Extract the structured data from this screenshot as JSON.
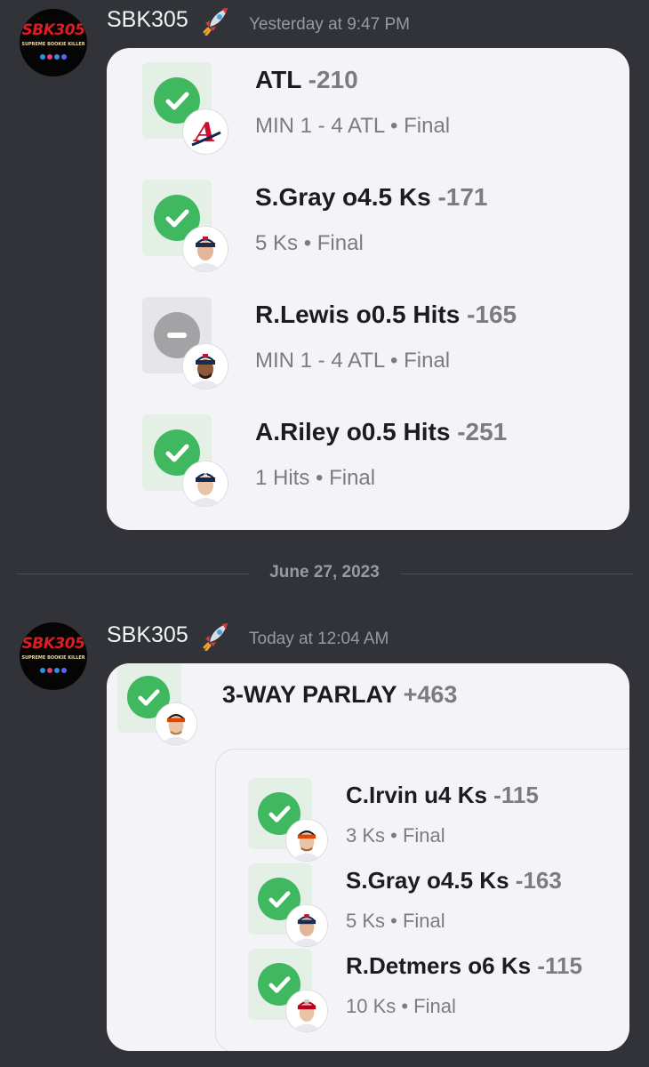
{
  "messages": [
    {
      "username": "SBK305",
      "timestamp": "Yesterday at 9:47 PM",
      "avatar": {
        "logo_text": "SBK305",
        "logo_sub": "SUPREME BOOKIE KILLER"
      },
      "legs": [
        {
          "title": "ATL",
          "odds": "-210",
          "sub": "MIN 1 - 4 ATL • Final",
          "status": "win",
          "badge": "atlanta-braves-logo"
        },
        {
          "title": "S.Gray o4.5 Ks",
          "odds": "-171",
          "sub": "5 Ks • Final",
          "status": "win",
          "badge": "player-headshot"
        },
        {
          "title": "R.Lewis o0.5 Hits",
          "odds": "-165",
          "sub": "MIN 1 - 4 ATL • Final",
          "status": "push",
          "badge": "player-headshot"
        },
        {
          "title": "A.Riley o0.5 Hits",
          "odds": "-251",
          "sub": "1 Hits • Final",
          "status": "win",
          "badge": "player-headshot"
        }
      ]
    },
    {
      "username": "SBK305",
      "timestamp": "Today at 12:04 AM",
      "avatar": {
        "logo_text": "SBK305",
        "logo_sub": "SUPREME BOOKIE KILLER"
      },
      "parlay": {
        "title": "3-WAY PARLAY",
        "odds": "+463",
        "status": "win"
      },
      "legs": [
        {
          "title": "C.Irvin u4 Ks",
          "odds": "-115",
          "sub": "3 Ks • Final",
          "status": "win",
          "badge": "player-headshot"
        },
        {
          "title": "S.Gray o4.5 Ks",
          "odds": "-163",
          "sub": "5 Ks • Final",
          "status": "win",
          "badge": "player-headshot"
        },
        {
          "title": "R.Detmers o6 Ks",
          "odds": "-115",
          "sub": "10 Ks • Final",
          "status": "win",
          "badge": "player-headshot"
        }
      ]
    }
  ],
  "date_divider": "June 27, 2023",
  "colors": {
    "background": "#313338",
    "card": "#f4f4f8",
    "win": "#3fb85f",
    "push": "#a3a3a6"
  }
}
